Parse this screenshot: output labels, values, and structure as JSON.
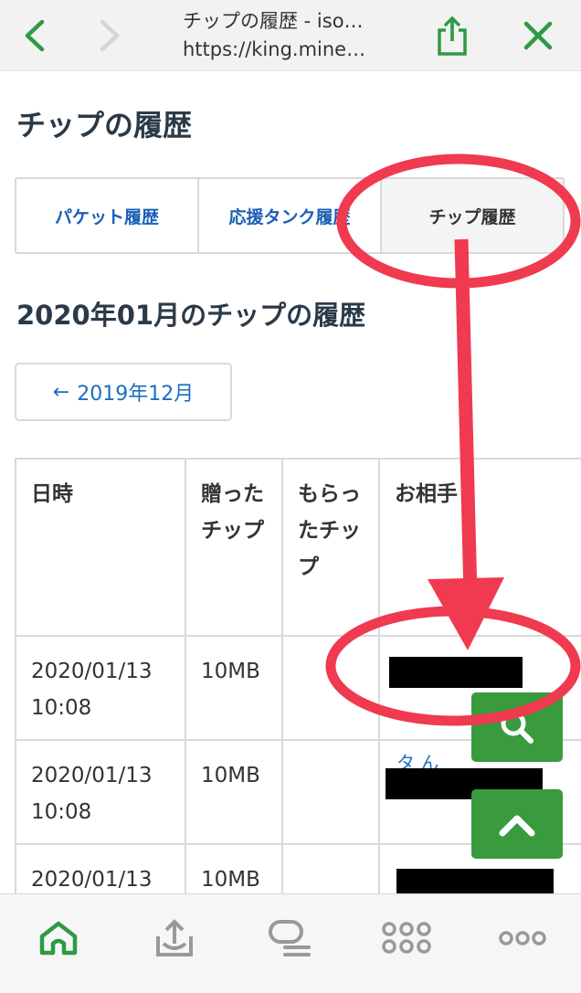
{
  "browser": {
    "title_line1": "チップの履歴 - iso…",
    "title_line2": "https://king.mine…"
  },
  "page_title": "チップの履歴",
  "tabs": [
    {
      "label": "パケット履歴",
      "active": false
    },
    {
      "label": "応援タンク履歴",
      "active": false
    },
    {
      "label": "チップ履歴",
      "active": true
    }
  ],
  "month_title": "2020年01月のチップの履歴",
  "prev_month": {
    "arrow": "←",
    "label": "2019年12月"
  },
  "table": {
    "headers": {
      "date": "日時",
      "sent": "贈ったチップ",
      "received": "もらったチップ",
      "partner": "お相手"
    },
    "rows": [
      {
        "date": "2020/01/13 10:08",
        "sent": "10MB",
        "received": "",
        "partner_peek": ""
      },
      {
        "date": "2020/01/13 10:08",
        "sent": "10MB",
        "received": "",
        "partner_peek": "タ  ん"
      },
      {
        "date": "2020/01/13",
        "sent": "10MB",
        "received": "",
        "partner_peek": ""
      }
    ]
  },
  "colors": {
    "accent_green": "#3a9a3e",
    "link_blue": "#1a6fc2",
    "annotation_red": "#f03a4f"
  },
  "icons": {
    "back": "chevron-left-icon",
    "forward": "chevron-right-icon",
    "share": "share-icon",
    "close": "close-icon",
    "search": "search-icon",
    "scroll_top": "chevron-up-icon",
    "home": "home-icon",
    "upload": "upload-icon",
    "chat": "chat-icon",
    "grid": "apps-icon",
    "more": "more-icon"
  }
}
